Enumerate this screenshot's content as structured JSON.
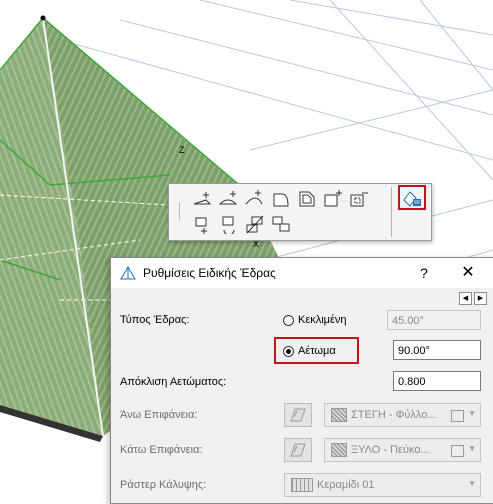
{
  "viewport": {
    "axis_z_label": "Z",
    "axis_x_label": "X"
  },
  "palette": {
    "row1_buttons": [
      "add-vertex-tool",
      "curved-edge-tool",
      "arc-edge-tool",
      "offset-edge-tool",
      "offset-all-edges-tool",
      "polygon-add-tool",
      "polygon-subtract-tool"
    ],
    "row2_buttons": [
      "move-tool",
      "rotate-tool",
      "mirror-tool",
      "multiply-tool"
    ],
    "active_button": "custom-plane-settings-tool"
  },
  "dialog": {
    "title": "Ρυθμίσεις Ειδικής Έδρας",
    "help_label": "?",
    "close_label": "✕",
    "nav_left": "◀",
    "nav_right": "▶",
    "plane_type_label": "Τύπος Έδρας:",
    "option_sloped": "Κεκλιμένη",
    "option_gable": "Αέτωμα",
    "sloped_value": "45.00°",
    "gable_value": "90.00°",
    "gable_offset_label": "Απόκλιση Αετώματος:",
    "gable_offset_value": "0.800",
    "top_surface_label": "Άνω Επιφάνεια:",
    "top_surface_value": "ΣΤΕΓΗ - Φύλλο...",
    "bottom_surface_label": "Κάτω Επιφάνεια:",
    "bottom_surface_value": "ΞΥΛΟ - Πεύκο...",
    "cover_fill_label": "Ράστερ Κάλυψης:",
    "cover_fill_value": "Κεραμίδι 01",
    "selected_option": "gable"
  },
  "colors": {
    "roof_green": "#7fa36a",
    "highlight_red": "#c0141b",
    "accent_blue": "#1e6fb8"
  }
}
